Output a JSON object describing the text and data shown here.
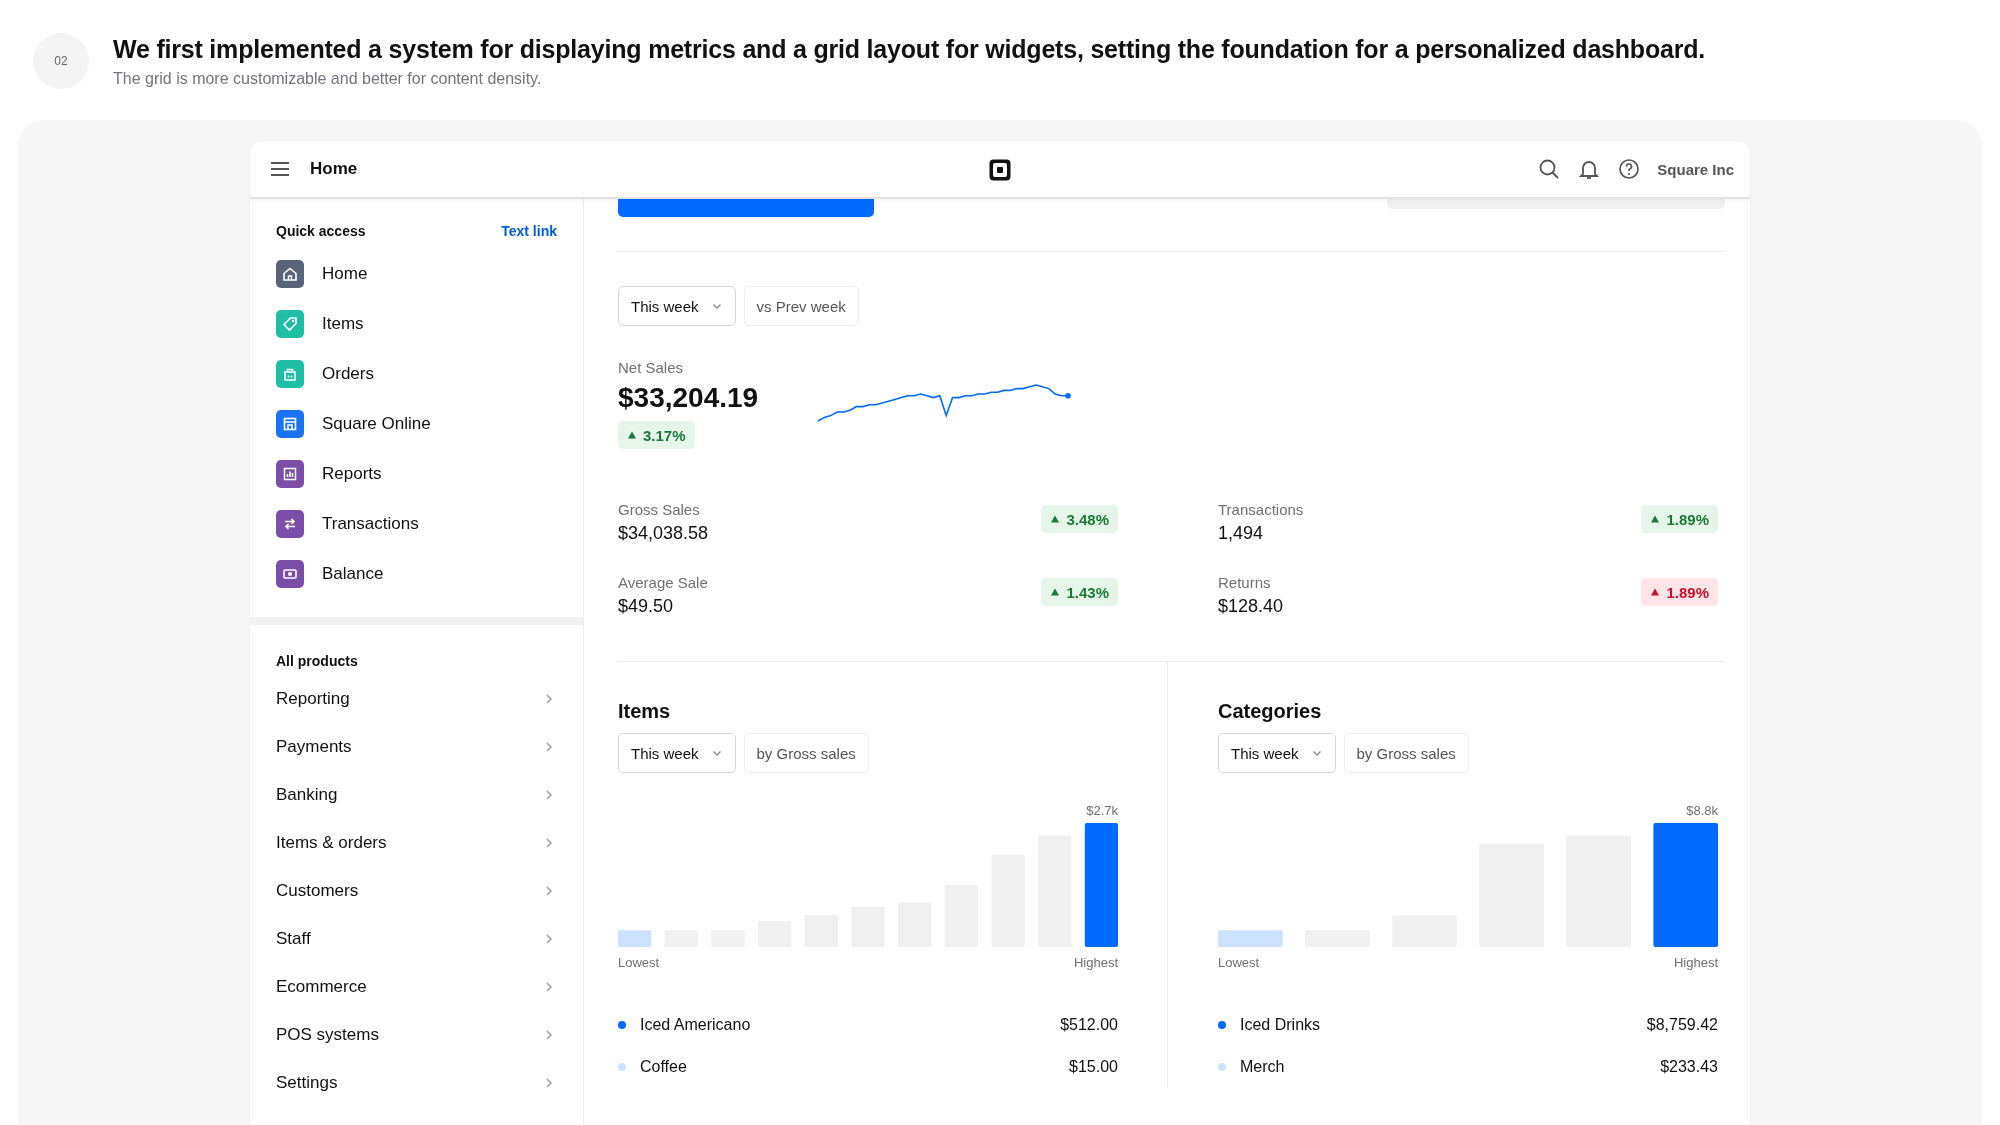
{
  "header": {
    "step": "02",
    "title": "We first implemented a system for displaying metrics and a grid layout for widgets, setting the foundation for a personalized dashboard.",
    "subtitle": "The grid is more customizable and better for content density."
  },
  "topbar": {
    "title": "Home",
    "account": "Square Inc"
  },
  "sidebar": {
    "quick_access": {
      "title": "Quick access",
      "link": "Text link",
      "items": [
        {
          "label": "Home",
          "kind": "home",
          "color": "#5a6478"
        },
        {
          "label": "Items",
          "kind": "tag",
          "color": "#1fbfa5"
        },
        {
          "label": "Orders",
          "kind": "bag",
          "color": "#1fbfa5"
        },
        {
          "label": "Square Online",
          "kind": "store",
          "color": "#1a73f5"
        },
        {
          "label": "Reports",
          "kind": "bars",
          "color": "#7b4fa8"
        },
        {
          "label": "Transactions",
          "kind": "swap",
          "color": "#7b4fa8"
        },
        {
          "label": "Balance",
          "kind": "cash",
          "color": "#7b4fa8"
        }
      ]
    },
    "all_products": {
      "title": "All products",
      "items": [
        "Reporting",
        "Payments",
        "Banking",
        "Items & orders",
        "Customers",
        "Staff",
        "Ecommerce",
        "POS systems",
        "Settings"
      ]
    }
  },
  "main": {
    "filters": [
      {
        "label": "This week",
        "kind": "dropdown"
      },
      {
        "label": "vs Prev week",
        "kind": "chip"
      }
    ],
    "net_sales": {
      "label": "Net Sales",
      "value": "$33,204.19",
      "change": "3.17%",
      "kind": "positive"
    },
    "metrics": [
      {
        "label": "Gross Sales",
        "value": "$34,038.58",
        "change": "3.48%",
        "kind": "positive"
      },
      {
        "label": "Transactions",
        "value": "1,494",
        "change": "1.89%",
        "kind": "positive"
      },
      {
        "label": "Average Sale",
        "value": "$49.50",
        "change": "1.43%",
        "kind": "positive"
      },
      {
        "label": "Returns",
        "value": "$128.40",
        "change": "1.89%",
        "kind": "negative"
      }
    ],
    "panels": [
      {
        "title": "Items",
        "filters": [
          {
            "label": "This week",
            "kind": "dropdown"
          },
          {
            "label": "by Gross sales",
            "kind": "chip"
          }
        ],
        "max_label": "$2.7k",
        "low_label": "Lowest",
        "high_label": "Highest",
        "legend": [
          {
            "name": "Iced Americano",
            "value": "$512.00",
            "color": "#006aff"
          },
          {
            "name": "Coffee",
            "value": "$15.00",
            "color": "#cce0ff"
          }
        ]
      },
      {
        "title": "Categories",
        "filters": [
          {
            "label": "This week",
            "kind": "dropdown"
          },
          {
            "label": "by Gross sales",
            "kind": "chip"
          }
        ],
        "max_label": "$8.8k",
        "low_label": "Lowest",
        "high_label": "Highest",
        "legend": [
          {
            "name": "Iced Drinks",
            "value": "$8,759.42",
            "color": "#006aff"
          },
          {
            "name": "Merch",
            "value": "$233.43",
            "color": "#cce0ff"
          }
        ]
      }
    ]
  }
}
